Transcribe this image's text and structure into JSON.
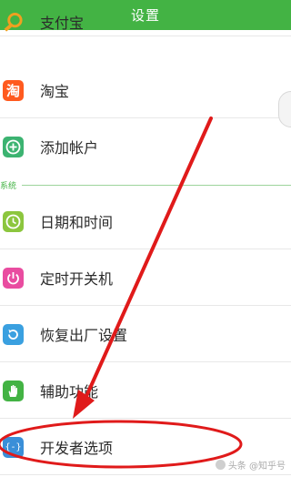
{
  "title": "设置",
  "rows": [
    {
      "label": "支付宝",
      "icon": "alipay-search-icon",
      "color": "#f0a020"
    },
    {
      "label": "淘宝",
      "icon": "taobao-icon",
      "icon_text": "淘",
      "color": "#ff5a1f"
    },
    {
      "label": "添加帐户",
      "icon": "add-account-icon",
      "color": "#3cb371"
    }
  ],
  "section": {
    "label": "系统"
  },
  "system_rows": [
    {
      "label": "日期和时间",
      "icon": "clock-icon",
      "color": "#8cc63e"
    },
    {
      "label": "定时开关机",
      "icon": "power-icon",
      "color": "#e94ca0"
    },
    {
      "label": "恢复出厂设置",
      "icon": "restore-icon",
      "color": "#3aa0e0"
    },
    {
      "label": "辅助功能",
      "icon": "hand-icon",
      "color": "#43b344"
    },
    {
      "label": "开发者选项",
      "icon": "developer-icon",
      "icon_text": "{-}",
      "color": "#3a8fd8"
    }
  ],
  "watermark": "头条 @知乎号",
  "annotation_colors": {
    "arrow": "#e01a1a"
  }
}
